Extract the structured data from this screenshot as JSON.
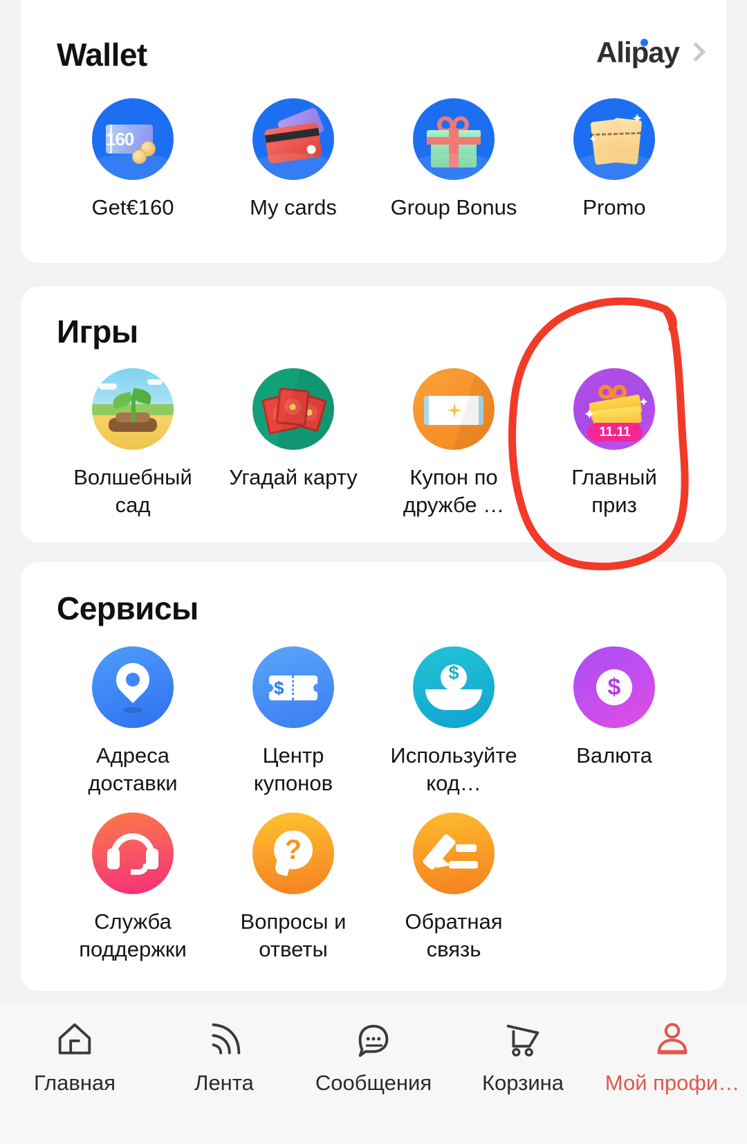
{
  "theme": {
    "page_bg": "#f2f2f2",
    "card_bg": "#ffffff",
    "text": "#151515",
    "accent_red": "#e2574c",
    "annotation_red": "#f23a28",
    "alipay_blue": "#1677ff"
  },
  "wallet": {
    "title": "Wallet",
    "brand": "Alipay",
    "chevron_icon": "chevron-right-icon",
    "items": [
      {
        "label": "Get€160",
        "icon": "voucher-coins-icon",
        "amount": "160"
      },
      {
        "label": "My cards",
        "icon": "credit-cards-icon"
      },
      {
        "label": "Group Bonus",
        "icon": "gift-box-icon"
      },
      {
        "label": "Promo",
        "icon": "promo-tickets-icon"
      }
    ]
  },
  "games": {
    "title": "Игры",
    "items": [
      {
        "label": "Волшебный\nсад",
        "icon": "sprout-garden-icon"
      },
      {
        "label": "Угадай карту",
        "icon": "red-envelope-cards-icon"
      },
      {
        "label": "Купон по\nдружбе …",
        "icon": "coupon-note-icon"
      },
      {
        "label": "Главный приз",
        "icon": "grand-prize-gift-icon",
        "badge": "11.11",
        "annotated": true
      }
    ]
  },
  "services": {
    "title": "Сервисы",
    "items": [
      {
        "label": "Адреса\nдоставки",
        "icon": "map-pin-icon"
      },
      {
        "label": "Центр\nкупонов",
        "icon": "coupon-ticket-icon",
        "symbol": "$"
      },
      {
        "label": "Используйте\nкод…",
        "icon": "hand-coin-icon"
      },
      {
        "label": "Валюта",
        "icon": "currency-icon",
        "symbol": "$"
      },
      {
        "label": "Служба\nподдержки",
        "icon": "headset-support-icon"
      },
      {
        "label": "Вопросы и\nответы",
        "icon": "question-bubble-icon",
        "symbol": "?"
      },
      {
        "label": "Обратная\nсвязь",
        "icon": "feedback-pen-icon"
      }
    ]
  },
  "bottom_nav": {
    "items": [
      {
        "label": "Главная",
        "icon": "home-icon",
        "active": false
      },
      {
        "label": "Лента",
        "icon": "feed-rss-icon",
        "active": false
      },
      {
        "label": "Сообщения",
        "icon": "message-bubble-icon",
        "active": false
      },
      {
        "label": "Корзина",
        "icon": "cart-icon",
        "active": false
      },
      {
        "label": "Мой профи…",
        "icon": "person-icon",
        "active": true
      }
    ]
  }
}
